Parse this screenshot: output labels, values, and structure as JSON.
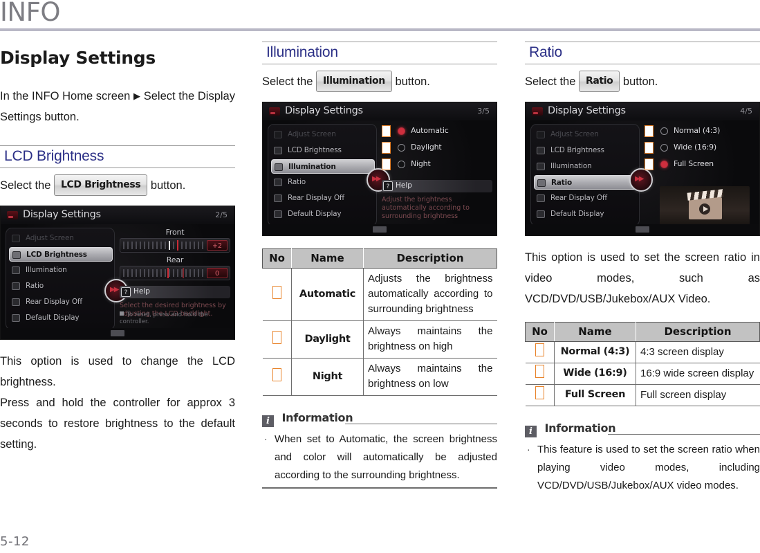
{
  "header": {
    "title": "INFO"
  },
  "page": {
    "number": "5-12"
  },
  "col1": {
    "big_title": "Display Settings",
    "intro_a": "In the INFO Home screen",
    "intro_arrow": "▶",
    "intro_b": "Select the",
    "intro_c": "Display Settings button.",
    "section": "LCD Brightness",
    "select_pre": "Select the",
    "select_chip": "LCD Brightness",
    "select_post": "button.",
    "shot": {
      "title": "Display Settings",
      "page": "2/5",
      "menu": [
        "Adjust Screen",
        "LCD Brightness",
        "Illumination",
        "Ratio",
        "Rear Display Off",
        "Default Display"
      ],
      "selected_menu": "LCD Brightness",
      "front_label": "Front",
      "front_value": "+2",
      "rear_label": "Rear",
      "rear_value": "0",
      "help_badge": "?",
      "help_label": "Help",
      "help_text": "Select the desired brightness by adjusting the LCD backlight.",
      "reset_text": "To reset, press and hold the controller."
    },
    "para1": "This option is used to change the LCD brightness.",
    "para2": "Press and hold the controller for approx 3 seconds to restore brightness to the default setting."
  },
  "col2": {
    "section": "Illumination",
    "select_pre": "Select the",
    "select_chip": "Illumination",
    "select_post": "button.",
    "shot": {
      "title": "Display Settings",
      "page": "3/5",
      "menu": [
        "Adjust Screen",
        "LCD Brightness",
        "Illumination",
        "Ratio",
        "Rear Display Off",
        "Default Display"
      ],
      "selected_menu": "Illumination",
      "options": [
        {
          "label": "Automatic",
          "selected": true
        },
        {
          "label": "Daylight",
          "selected": false
        },
        {
          "label": "Night",
          "selected": false
        }
      ],
      "help_badge": "?",
      "help_label": "Help",
      "help_text": "Adjust the brightness automatically according to surrounding brightness"
    },
    "table": {
      "headers": [
        "No",
        "Name",
        "Description"
      ],
      "rows": [
        {
          "no": "",
          "name": "Automatic",
          "desc": "Adjusts the brightness automatically according to surrounding brightness"
        },
        {
          "no": "",
          "name": "Daylight",
          "desc": "Always maintains the brightness on high"
        },
        {
          "no": "",
          "name": "Night",
          "desc": "Always maintains the brightness on low"
        }
      ]
    },
    "information": {
      "label": "Information",
      "bullet": "·",
      "text": "When set to Automatic, the screen brightness and color will automatically be adjusted according to the surrounding brightness."
    }
  },
  "col3": {
    "section": "Ratio",
    "select_pre": "Select the",
    "select_chip": "Ratio",
    "select_post": "button.",
    "shot": {
      "title": "Display Settings",
      "page": "4/5",
      "menu": [
        "Adjust Screen",
        "LCD Brightness",
        "Illumination",
        "Ratio",
        "Rear Display Off",
        "Default Display"
      ],
      "selected_menu": "Ratio",
      "options": [
        {
          "label": "Normal (4:3)",
          "selected": false
        },
        {
          "label": "Wide (16:9)",
          "selected": false
        },
        {
          "label": "Full Screen",
          "selected": true
        }
      ]
    },
    "para1": "This option is used to set the screen ratio in video modes, such as VCD/DVD/USB/Jukebox/AUX Video.",
    "table": {
      "headers": [
        "No",
        "Name",
        "Description"
      ],
      "rows": [
        {
          "no": "",
          "name": "Normal (4:3)",
          "desc": "4:3 screen display"
        },
        {
          "no": "",
          "name": "Wide (16:9)",
          "desc": "16:9 wide screen display"
        },
        {
          "no": "",
          "name": "Full Screen",
          "desc": "Full screen display"
        }
      ]
    },
    "information": {
      "label": "Information",
      "bullet": "·",
      "text": "This feature is used to set the screen ratio when playing video modes, including VCD/DVD/USB/Jukebox/AUX video modes."
    }
  },
  "colors": {
    "section_blue": "#2b2f86",
    "header_gray": "#7d7d83",
    "rule": "#b9b8c6",
    "table_header": "#c2c2c2",
    "placeholder_orange": "#e8832a"
  }
}
